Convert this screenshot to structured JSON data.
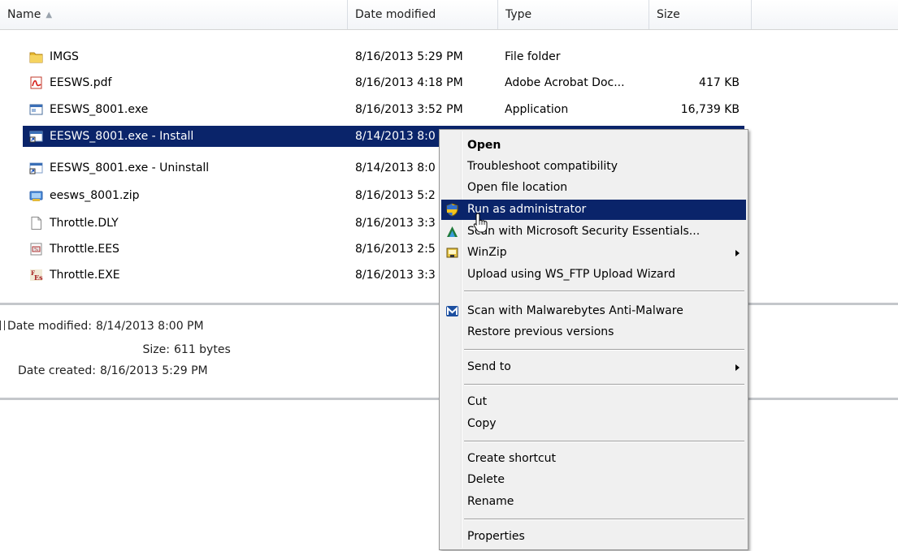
{
  "columns": {
    "name": "Name",
    "date": "Date modified",
    "type": "Type",
    "size": "Size"
  },
  "files": [
    {
      "name": "IMGS",
      "date": "8/16/2013 5:29 PM",
      "type": "File folder",
      "size": "",
      "icon": "folder-icon"
    },
    {
      "name": "EESWS.pdf",
      "date": "8/16/2013 4:18 PM",
      "type": "Adobe Acrobat Doc...",
      "size": "417 KB",
      "icon": "pdf-icon"
    },
    {
      "name": "EESWS_8001.exe",
      "date": "8/16/2013 3:52 PM",
      "type": "Application",
      "size": "16,739 KB",
      "icon": "application-icon"
    },
    {
      "name": "EESWS_8001.exe - Install",
      "date": "8/14/2013 8:0",
      "type": "",
      "size": "",
      "icon": "shortcut-icon",
      "selected": true
    },
    {
      "name": "EESWS_8001.exe - Uninstall",
      "date": "8/14/2013 8:0",
      "type": "",
      "size": "",
      "icon": "shortcut-icon"
    },
    {
      "name": "eesws_8001.zip",
      "date": "8/16/2013 5:2",
      "type": "",
      "size": "",
      "icon": "zip-icon"
    },
    {
      "name": "Throttle.DLY",
      "date": "8/16/2013 3:3",
      "type": "",
      "size": "",
      "icon": "file-icon"
    },
    {
      "name": "Throttle.EES",
      "date": "8/16/2013 2:5",
      "type": "",
      "size": "",
      "icon": "ees-file-icon"
    },
    {
      "name": "Throttle.EXE",
      "date": "8/16/2013 3:3",
      "type": "",
      "size": "",
      "icon": "ees-exe-icon"
    }
  ],
  "details": {
    "date_modified_label": "Date modified:",
    "date_modified": "8/14/2013 8:00 PM",
    "size_label": "Size:",
    "size": "611 bytes",
    "date_created_label": "Date created:",
    "date_created": "8/16/2013 5:29 PM"
  },
  "context_menu": {
    "open": "Open",
    "troubleshoot": "Troubleshoot compatibility",
    "open_location": "Open file location",
    "run_as_admin": "Run as administrator",
    "scan_mse": "Scan with Microsoft Security Essentials...",
    "winzip": "WinZip",
    "upload_wsftp": "Upload using WS_FTP Upload Wizard",
    "scan_malwarebytes": "Scan with Malwarebytes Anti-Malware",
    "restore": "Restore previous versions",
    "send_to": "Send to",
    "cut": "Cut",
    "copy": "Copy",
    "create_shortcut": "Create shortcut",
    "delete": "Delete",
    "rename": "Rename",
    "properties": "Properties"
  },
  "colors": {
    "selection": "#0a246a",
    "menu_background": "#f0f0f0"
  }
}
